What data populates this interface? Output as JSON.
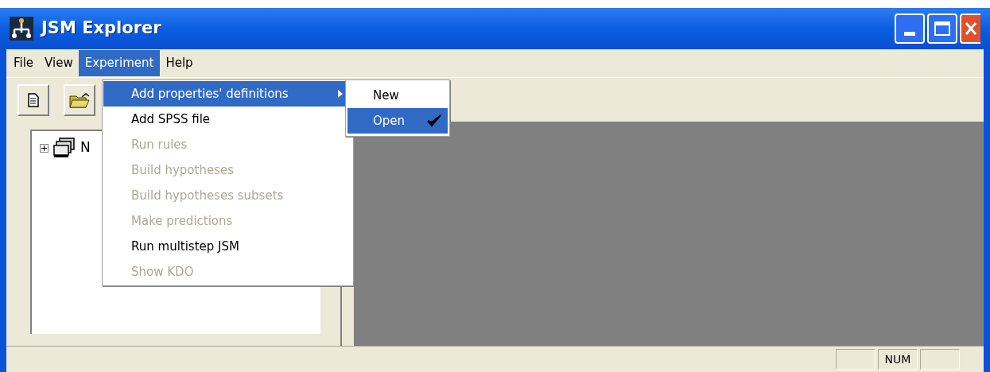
{
  "window": {
    "title": "JSM Explorer"
  },
  "menu_bar": [
    {
      "label": "File",
      "selected": false
    },
    {
      "label": "View",
      "selected": false
    },
    {
      "label": "Experiment",
      "selected": true
    },
    {
      "label": "Help",
      "selected": false
    }
  ],
  "toolbar": [
    {
      "kind": "new"
    },
    {
      "kind": "open"
    }
  ],
  "tree": {
    "items": [
      {
        "label": "N",
        "expanded": false
      }
    ]
  },
  "menu": {
    "items": [
      {
        "label": "Add properties' definitions",
        "selected": true,
        "disabled": false,
        "submenu": true
      },
      {
        "label": "Add SPSS file",
        "selected": false,
        "disabled": false,
        "submenu": false
      },
      {
        "label": "Run rules",
        "selected": false,
        "disabled": true,
        "submenu": false
      },
      {
        "label": "Build hypotheses",
        "selected": false,
        "disabled": true,
        "submenu": false
      },
      {
        "label": "Build hypotheses subsets",
        "selected": false,
        "disabled": true,
        "submenu": false
      },
      {
        "label": "Make predictions",
        "selected": false,
        "disabled": true,
        "submenu": false
      },
      {
        "label": "Run multistep JSM",
        "selected": false,
        "disabled": false,
        "submenu": false
      },
      {
        "label": "Show KDO",
        "selected": false,
        "disabled": true,
        "submenu": false
      }
    ]
  },
  "submenu": {
    "items": [
      {
        "label": "New",
        "selected": false,
        "checked": false
      },
      {
        "label": "Open",
        "selected": true,
        "checked": true
      }
    ]
  },
  "status_bar": {
    "panels": [
      {
        "kind": "blank"
      },
      {
        "kind": "text",
        "text": "NUM"
      },
      {
        "kind": "blank"
      }
    ]
  }
}
